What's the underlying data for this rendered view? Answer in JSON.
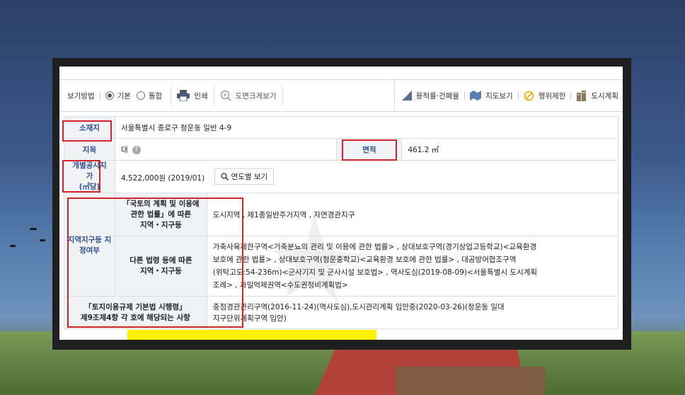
{
  "toolbar": {
    "view_method_label": "보기방법",
    "basic_label": "기본",
    "combined_label": "통합",
    "print_label": "인쇄",
    "enlarge_map_label": "도면크게보기",
    "ratio_label": "용적률·건폐율",
    "map_view_label": "지도보기",
    "restriction_label": "행위제한",
    "urban_plan_label": "도시계획"
  },
  "info": {
    "location_label": "소재지",
    "location_value": "서울특별시 종로구 청운동 일반 4-9",
    "land_category_label": "지목",
    "land_category_value": "대",
    "area_label": "면적",
    "area_value": "461.2 ㎡",
    "price_label_line1": "개별공시지가",
    "price_label_line2": "(㎡당)",
    "price_value": "4,522,000원 (2019/01)",
    "year_button_label": "연도별 보기",
    "zone_label": "지역지구등 지정여부",
    "zone_sub1_line1": "「국토의 계획 및 이용에",
    "zone_sub1_line2": "관한 법률」에 따른",
    "zone_sub1_line3": "지역・지구등",
    "zone_sub1_value": "도시지역 , 제1종일반주거지역 , 자연경관지구",
    "zone_sub2_line1": "다른 법령 등에 따른",
    "zone_sub2_line2": "지역・지구등",
    "zone_sub2_value_line1": "가축사육제한구역<가축분뇨의 관리 및 이용에 관한 법률> , 상대보호구역(경기상업고등학교)<교육환경",
    "zone_sub2_value_line2": "보호에 관한 법률> , 상대보호구역(청운중학교)<교육환경 보호에 관한 법률> , 대공방어협조구역",
    "zone_sub2_value_line3": "(위탁고도:54-236m)<군사기지 및 군사시설 보호법> , 역사도심(2019-08-09)<서울특별시 도시계획",
    "zone_sub2_value_line4": "조례> , 과밀억제권역<수도권정비계획법>",
    "enforcement_label_line1": "「토지이용규제 기본법 시행령」",
    "enforcement_label_line2": "제9조제4항 각 호에 해당되는 사항",
    "enforcement_value_line1": "중점경관관리구역(2016-11-24)(역사도심),도시관리계획 입안중(2020-03-26)(청운동 일대",
    "enforcement_value_line2": "지구단위계획구역 입안)"
  },
  "colors": {
    "label_blue": "#2d4f8f",
    "highlight_red": "#d4232b"
  }
}
